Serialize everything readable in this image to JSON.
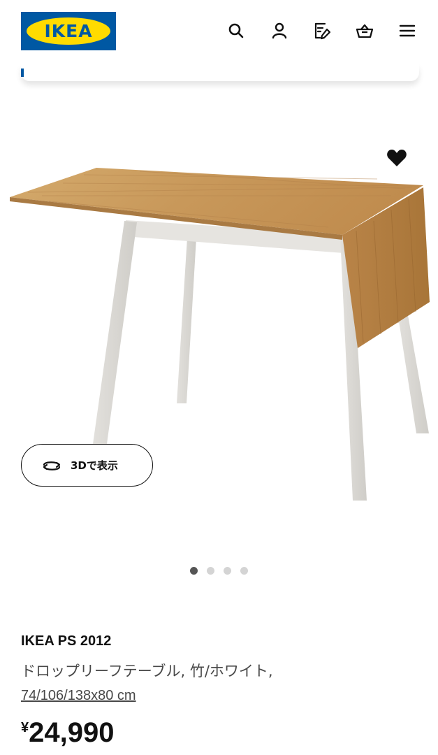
{
  "header": {
    "logo_text": "IKEA",
    "icons": [
      "search-icon",
      "account-icon",
      "shopping-list-icon",
      "cart-icon",
      "menu-icon"
    ]
  },
  "product": {
    "favorite_icon": "heart-icon",
    "view_3d_label": "3Dで表示",
    "gallery": {
      "image_count": 4,
      "active_index": 0
    },
    "name": "IKEA PS 2012",
    "description": "ドロップリーフテーブル, 竹/ホワイト,",
    "dimensions": "74/106/138x80 cm",
    "price_currency": "¥",
    "price_value": "24,990"
  },
  "colors": {
    "brand_blue": "#0058a3",
    "brand_yellow": "#ffdb00",
    "table_top": "#c99a5b",
    "table_frame": "#dcdad6"
  }
}
